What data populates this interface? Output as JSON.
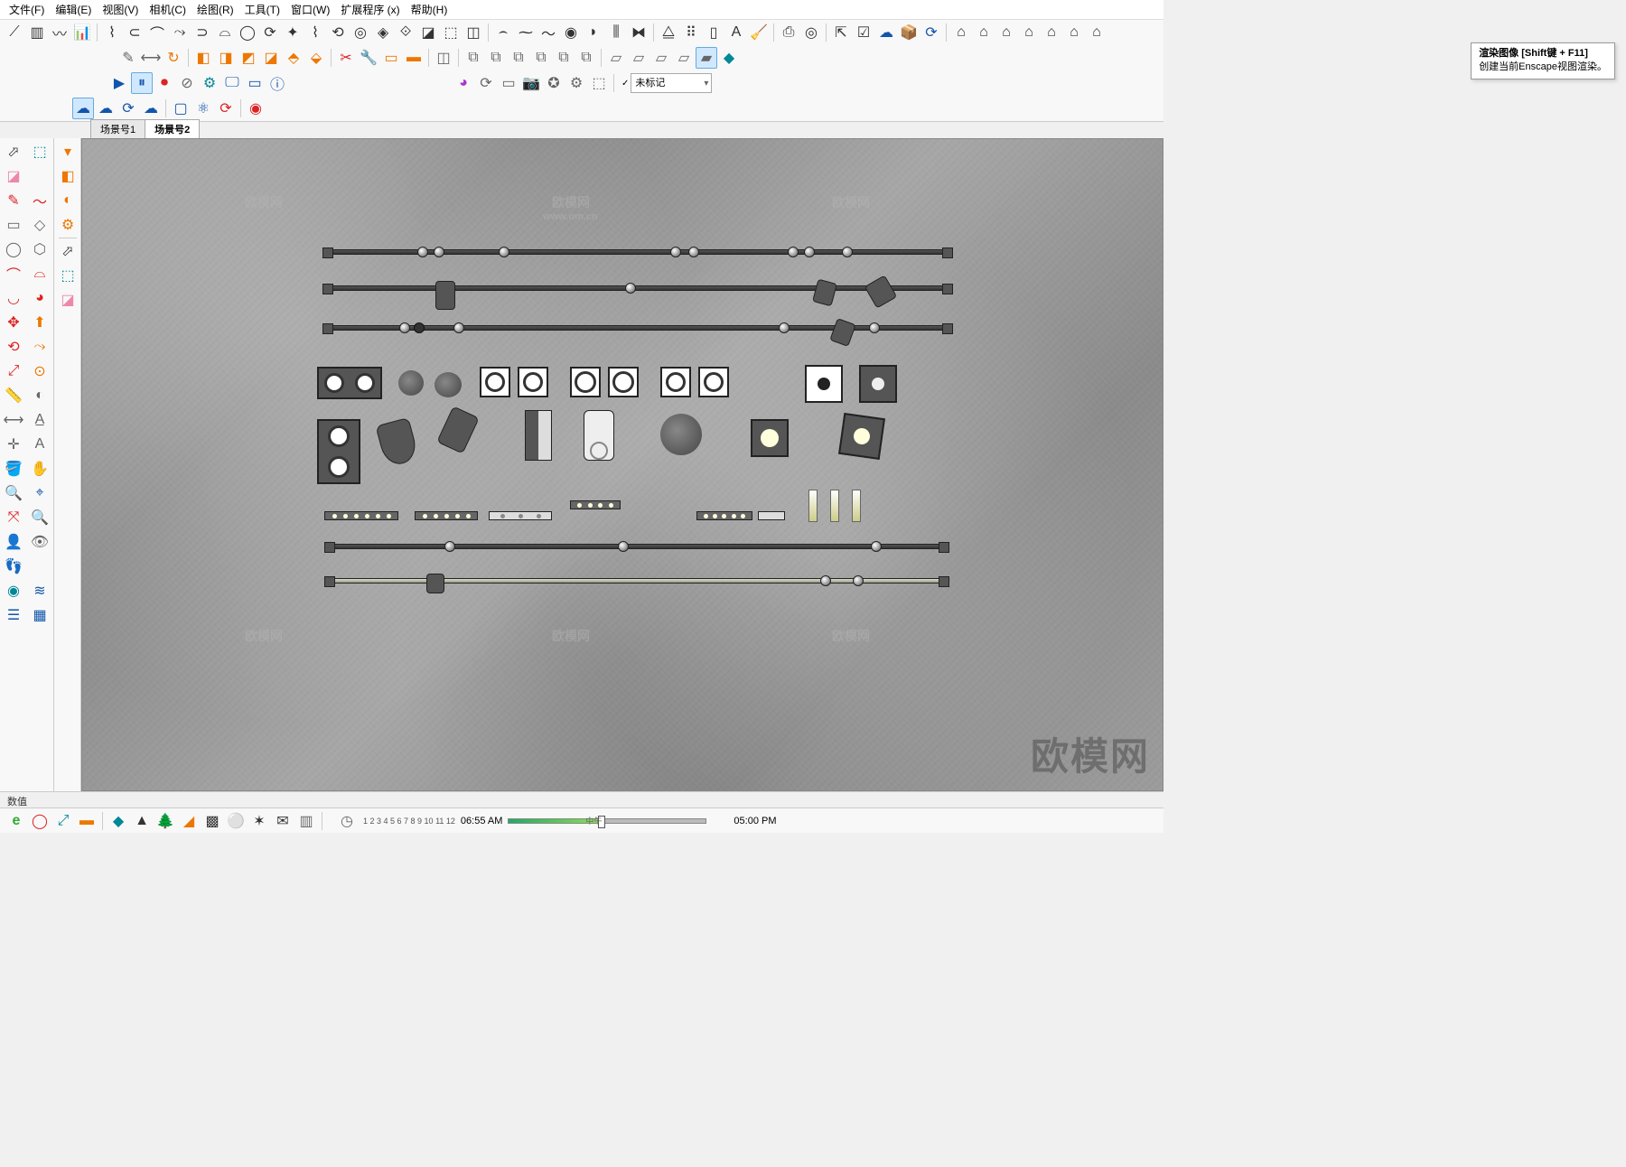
{
  "menu": {
    "file": "文件(F)",
    "edit": "编辑(E)",
    "view": "视图(V)",
    "camera": "相机(C)",
    "draw": "绘图(R)",
    "tools": "工具(T)",
    "window": "窗口(W)",
    "extensions": "扩展程序 (x)",
    "help": "帮助(H)"
  },
  "tooltip": {
    "title": "渲染图像 [Shift键 + F11]",
    "body": "创建当前Enscape视图渲染。"
  },
  "scene_tabs": {
    "tab1": "场景号1",
    "tab2": "场景号2"
  },
  "tag_select": {
    "value": "未标记",
    "check": "✓"
  },
  "statusbar": {
    "label": "数值"
  },
  "time": {
    "months": "1 2 3 4 5 6 7 8 9 10 11 12",
    "start": "06:55 AM",
    "mid": "中午",
    "end": "05:00 PM"
  },
  "watermark": {
    "main": "欧模网",
    "small": "欧模网",
    "url": "www.om.cn"
  },
  "colors": {
    "active_blue": "#d0e8ff",
    "toolbar_bg": "#f8f8f8"
  }
}
